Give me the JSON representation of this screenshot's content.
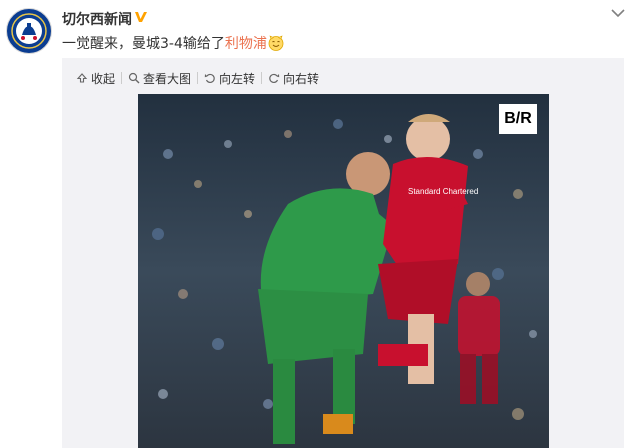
{
  "account": {
    "name": "切尔西新闻",
    "avatar_icon": "chelsea-crest-icon",
    "verified_icon": "verified-v-icon"
  },
  "post": {
    "text": "一觉醒来，曼城3-4输给了",
    "link_text": "利物浦",
    "emoji_icon": "smiling-face-emoji-icon"
  },
  "toolbar": {
    "collapse": "收起",
    "view_large": "查看大图",
    "rotate_left": "向左转",
    "rotate_right": "向右转"
  },
  "image": {
    "watermark": "B/R",
    "sponsor": "Standard Chartered"
  },
  "colors": {
    "link": "#eb7350",
    "verified": "#ffa200",
    "toolbar_bg": "#f2f2f5"
  }
}
